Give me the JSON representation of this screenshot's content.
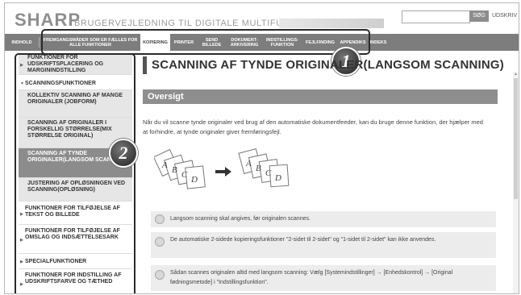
{
  "header": {
    "logo": "SHARP",
    "site_title": "BRUGERVEJLEDNING TIL DIGITALE MULTIFUNKTIONSSYSTEM",
    "search_button": "SØG",
    "print_link": "UDSKRIV"
  },
  "tabs": [
    {
      "label": "INDHOLD"
    },
    {
      "label": "FREMGANGSMÅDER SOM ER FÆLLES FOR ALLE FUNKTIONER"
    },
    {
      "label": "KOPIERING"
    },
    {
      "label": "PRINTER"
    },
    {
      "label": "SEND BILLEDE"
    },
    {
      "label": "DOKUMENT-ARKIVERING"
    },
    {
      "label": "INDSTILLINGS-FUNKTION"
    },
    {
      "label": "FEJLFINDING"
    },
    {
      "label": "APPENDIKS"
    },
    {
      "label": "INDEKS"
    }
  ],
  "callouts": {
    "one": "1",
    "two": "2"
  },
  "sidebar": {
    "items": [
      {
        "label": "FUNKTIONER FOR UDSKRIFTSPLACERING OG MARGININDSTILLING"
      },
      {
        "label": "SCANNINGSFUNKTIONER"
      },
      {
        "label": "KOLLEKTIV SCANNING AF MANGE ORIGINALER (JOBFORM)"
      },
      {
        "label": "SCANNING AF ORIGINALER I FORSKELLIG STØRRELSE(MIX STØRRELSE ORIGINAL)"
      },
      {
        "label": "SCANNING AF TYNDE ORIGINALER(LANGSOM SCANNING)"
      },
      {
        "label": "JUSTERING AF OPLØSNINGEN VED SCANNING(OPLØSNING)"
      },
      {
        "label": "FUNKTIONER FOR TILFØJELSE AF TEKST OG BILLEDE"
      },
      {
        "label": "FUNKTIONER FOR TILFØJELSE AF OMSLAG OG INDSÆTTELSESARK"
      },
      {
        "label": "SPECIALFUNKTIONER"
      },
      {
        "label": "FUNKTIONER FOR INDSTILLING AF UDSKRIFTSFARVE OG TÆTHED"
      }
    ]
  },
  "content": {
    "page_title": "SCANNING AF TYNDE ORIGINALER(LANGSOM SCANNING)",
    "section_title": "Oversigt",
    "intro": "Når du vil scanne tynde originaler ved brug af den automatiske dokumentfeeder, kan du bruge denne funktion, der hjælper med at forhindre, at tynde originaler giver fremføringsfejl.",
    "notes": [
      {
        "text": "Langsom scanning skal angives, før originalen scannes."
      },
      {
        "text": "De automatiske 2-sidede kopieringsfunktioner \"2-sidet til 2-sidet\" og \"1-sidet til 2-sidet\" kan ikke anvendes."
      },
      {
        "text": "Sådan scannes originalen altid med langsom scanning: Vælg [Systemindstillinger] → [Enhedskontrol] → [Original fødningsmetode] i \"Indstillingsfunktion\"."
      }
    ],
    "illustration_letters": [
      "A",
      "B",
      "C",
      "D"
    ]
  }
}
